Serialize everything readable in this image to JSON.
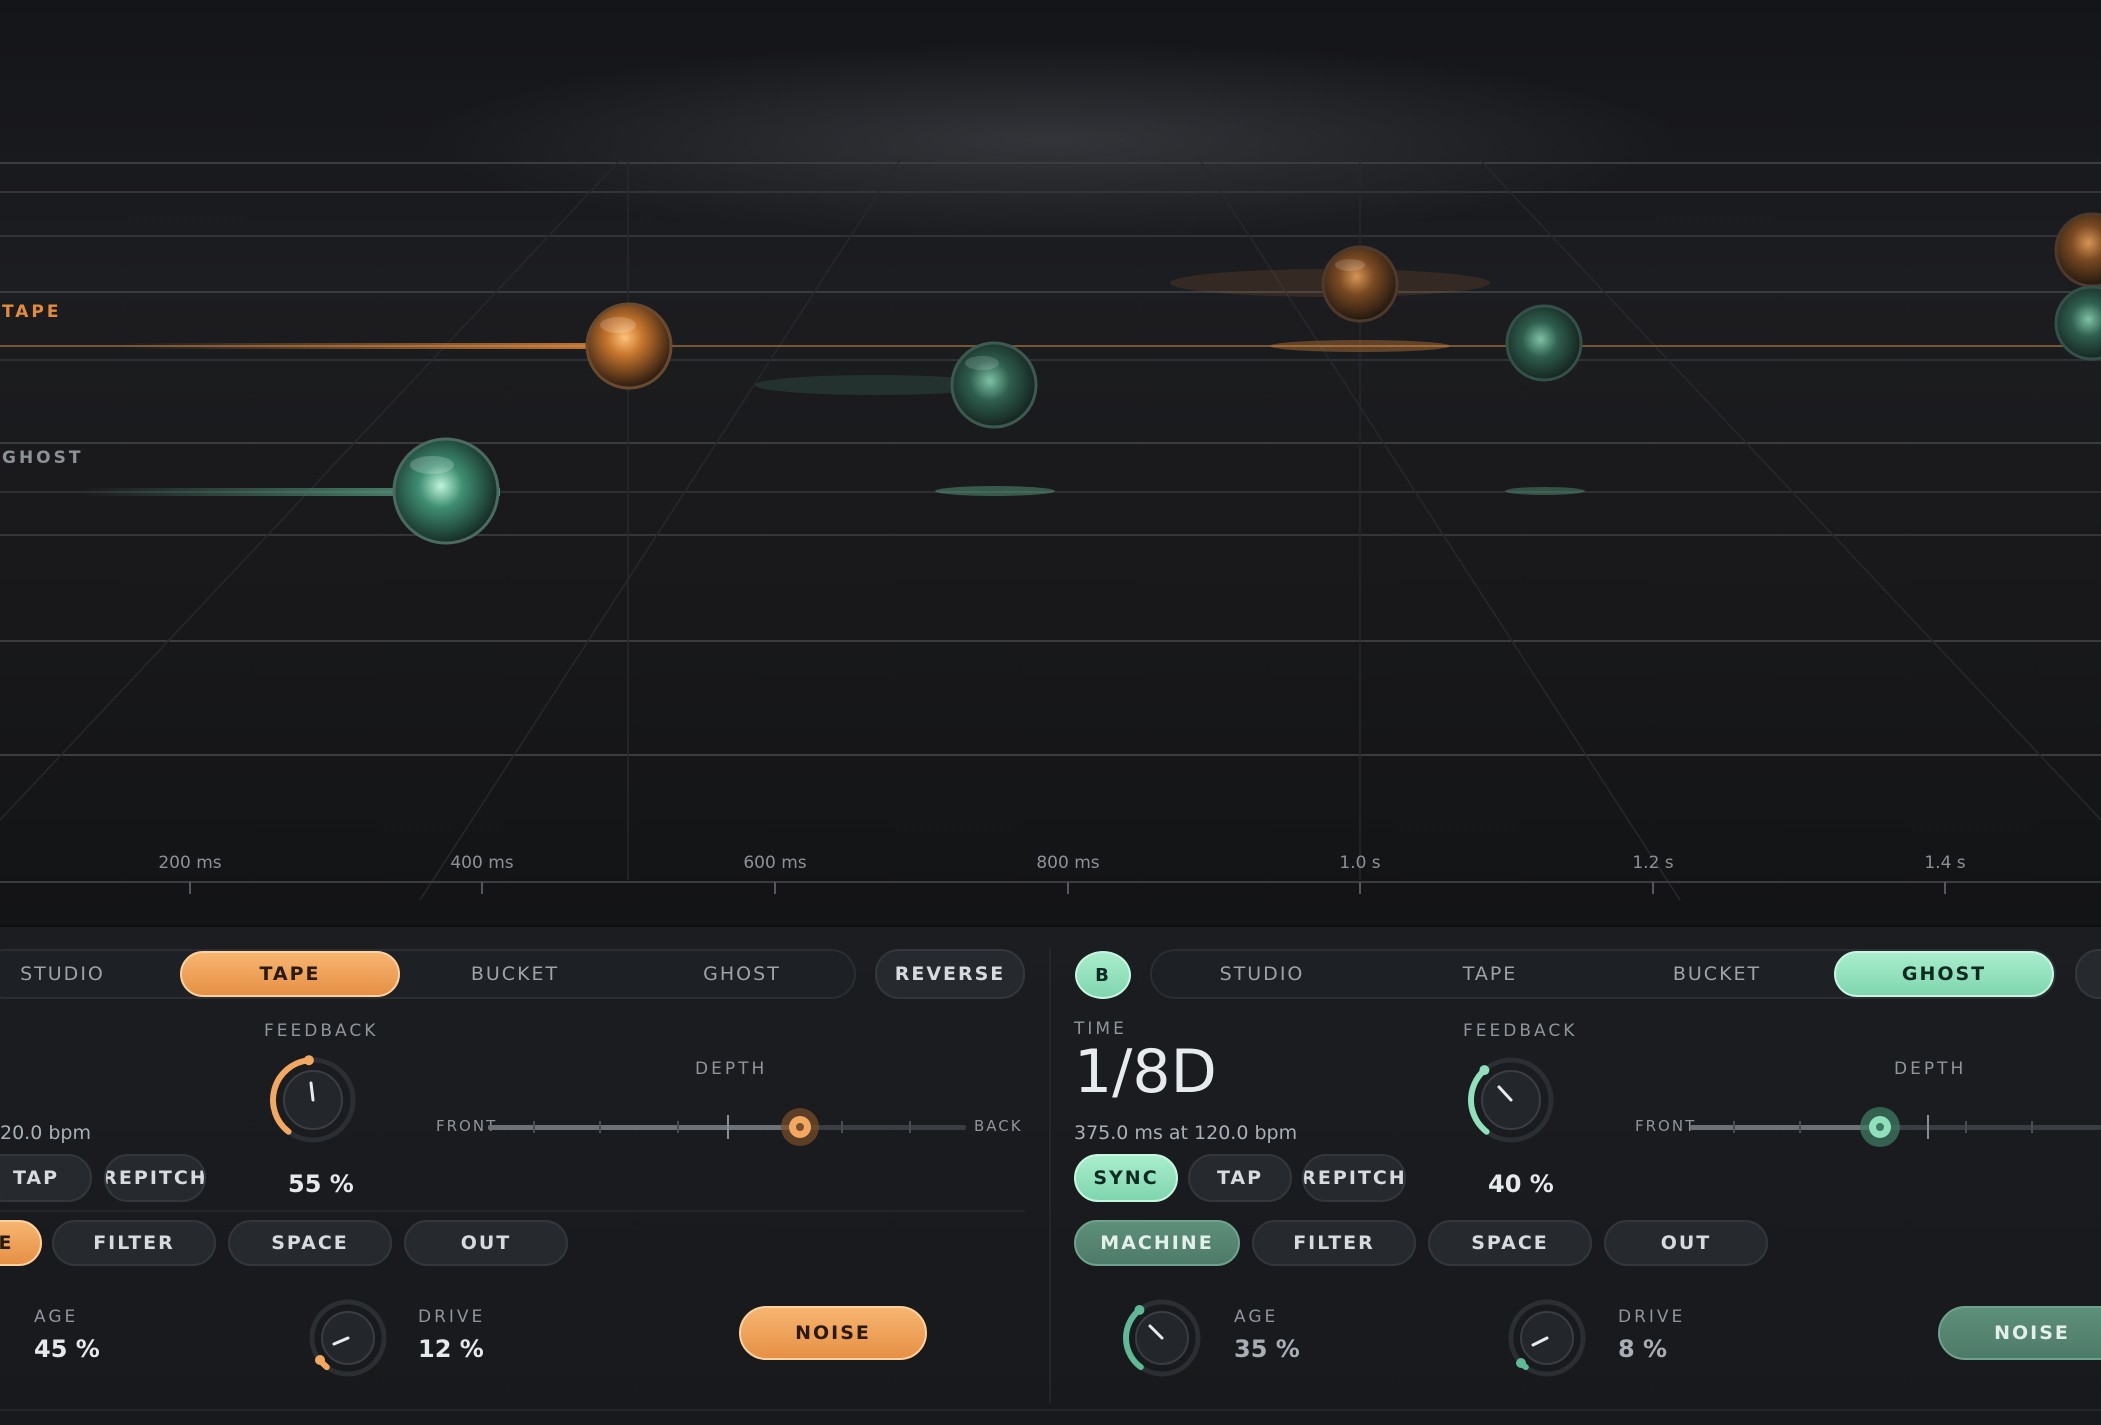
{
  "visualizer": {
    "tracks": [
      {
        "label": "TAPE",
        "color": "#e58b3d"
      },
      {
        "label": "GHOST",
        "color": "#8d9197"
      }
    ],
    "time_ticks": [
      "200 ms",
      "400 ms",
      "600 ms",
      "800 ms",
      "1.0 s",
      "1.2 s",
      "1.4 s"
    ]
  },
  "colors": {
    "accent_orange": "#f2a861",
    "accent_green": "#8fe0bb",
    "background": "#15171a"
  },
  "deck_a": {
    "modes": [
      "STUDIO",
      "TAPE",
      "BUCKET",
      "GHOST"
    ],
    "active_mode": "TAPE",
    "reverse_label": "REVERSE",
    "tempo_text": "20.0 bpm",
    "tap_label": "TAP",
    "repitch_label": "REPITCH",
    "feedback_label": "FEEDBACK",
    "feedback_value": "55 %",
    "feedback_level": 0.55,
    "depth_label": "DEPTH",
    "depth_front": "FRONT",
    "depth_back": "BACK",
    "depth_level": 0.65,
    "tabs": [
      "E",
      "FILTER",
      "SPACE",
      "OUT"
    ],
    "age_label": "AGE",
    "age_value": "45 %",
    "drive_label": "DRIVE",
    "drive_value": "12 %",
    "drive_level": 0.12,
    "noise_label": "NOISE"
  },
  "deck_b": {
    "badge": "B",
    "modes": [
      "STUDIO",
      "TAPE",
      "BUCKET",
      "GHOST"
    ],
    "active_mode": "GHOST",
    "time_label": "TIME",
    "time_value": "1/8D",
    "time_sub": "375.0 ms at 120.0 bpm",
    "sync_label": "SYNC",
    "tap_label": "TAP",
    "repitch_label": "REPITCH",
    "feedback_label": "FEEDBACK",
    "feedback_value": "40 %",
    "feedback_level": 0.4,
    "depth_label": "DEPTH",
    "depth_front": "FRONT",
    "depth_level": 0.38,
    "tabs": [
      "MACHINE",
      "FILTER",
      "SPACE",
      "OUT"
    ],
    "age_label": "AGE",
    "age_value": "35 %",
    "age_level": 0.35,
    "drive_label": "DRIVE",
    "drive_value": "8 %",
    "drive_level": 0.08,
    "noise_label": "NOISE"
  }
}
